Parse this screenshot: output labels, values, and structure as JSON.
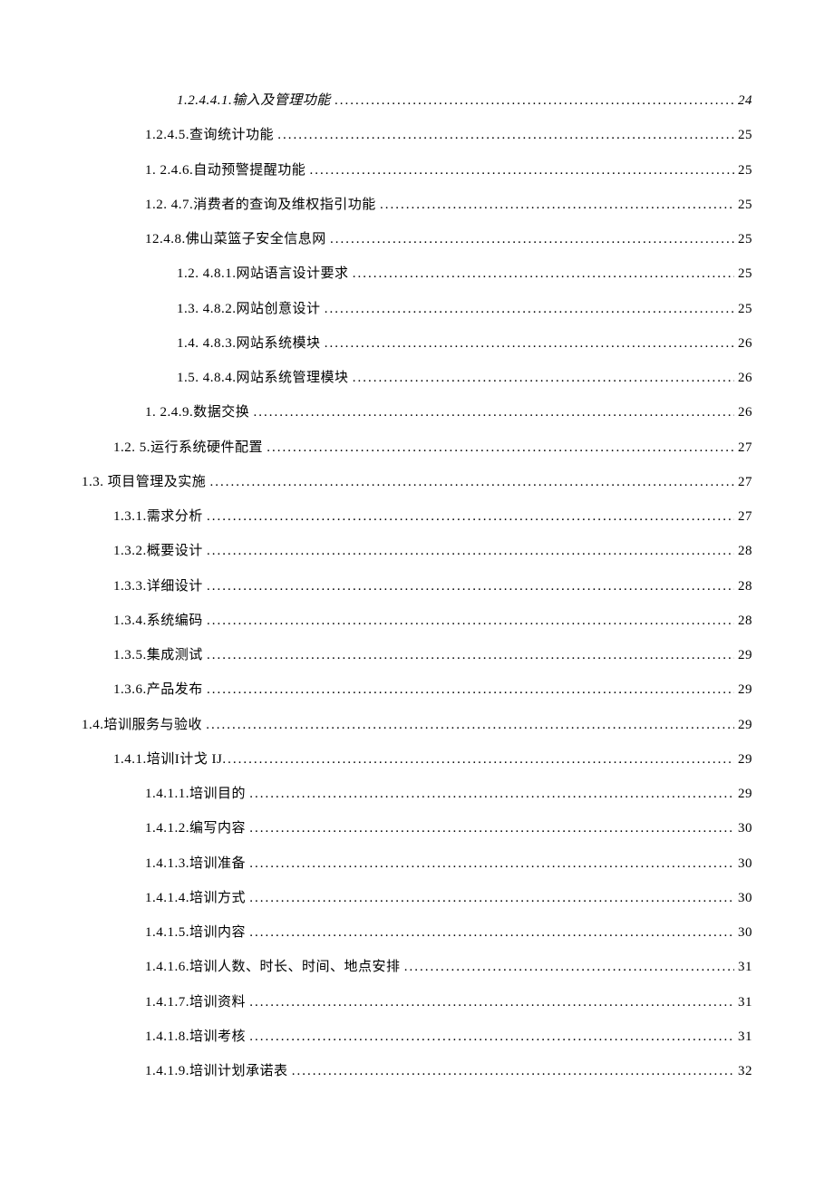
{
  "toc": [
    {
      "indent": 3,
      "label": "1.2.4.4.1.输入及管理功能 ",
      "page": "24",
      "italic": true
    },
    {
      "indent": 2,
      "label": "1.2.4.5.查询统计功能 ",
      "page": "25",
      "italic": false
    },
    {
      "indent": 2,
      "label": "1. 2.4.6.自动预警提醒功能 ",
      "page": "25",
      "italic": false
    },
    {
      "indent": 2,
      "label": "1.2. 4.7.消费者的查询及维权指引功能 ",
      "page": "25",
      "italic": false
    },
    {
      "indent": 2,
      "label": "12.4.8.佛山菜篮子安全信息网 ",
      "page": "25",
      "italic": false
    },
    {
      "indent": 3,
      "label": "1.2. 4.8.1.网站语言设计要求 ",
      "page": "25",
      "italic": false
    },
    {
      "indent": 3,
      "label": "1.3. 4.8.2.网站创意设计 ",
      "page": "25",
      "italic": false
    },
    {
      "indent": 3,
      "label": "1.4. 4.8.3.网站系统模块 ",
      "page": "26",
      "italic": false
    },
    {
      "indent": 3,
      "label": "1.5. 4.8.4.网站系统管理模块 ",
      "page": "26",
      "italic": false
    },
    {
      "indent": 2,
      "label": "1. 2.4.9.数据交换 ",
      "page": "26",
      "italic": false
    },
    {
      "indent": 1,
      "label": "1.2. 5.运行系统硬件配置 ",
      "page": "27",
      "italic": false
    },
    {
      "indent": 0,
      "label": "1.3. 项目管理及实施 ",
      "page": "27",
      "italic": false
    },
    {
      "indent": 1,
      "label": "1.3.1.需求分析 ",
      "page": "27",
      "italic": false
    },
    {
      "indent": 1,
      "label": "1.3.2.概要设计 ",
      "page": "28",
      "italic": false
    },
    {
      "indent": 1,
      "label": "1.3.3.详细设计 ",
      "page": "28",
      "italic": false
    },
    {
      "indent": 1,
      "label": "1.3.4.系统编码 ",
      "page": "28",
      "italic": false
    },
    {
      "indent": 1,
      "label": "1.3.5.集成测试 ",
      "page": "29",
      "italic": false
    },
    {
      "indent": 1,
      "label": "1.3.6.产品发布 ",
      "page": "29",
      "italic": false
    },
    {
      "indent": 0,
      "label": "1.4.培训服务与验收 ",
      "page": "29",
      "italic": false
    },
    {
      "indent": 1,
      "label": "1.4.1.培训I计戈 IJ",
      "page": "29",
      "italic": false
    },
    {
      "indent": 2,
      "label": "1.4.1.1.培训目的 ",
      "page": "29",
      "italic": false
    },
    {
      "indent": 2,
      "label": "1.4.1.2.编写内容 ",
      "page": "30",
      "italic": false
    },
    {
      "indent": 2,
      "label": "1.4.1.3.培训准备 ",
      "page": "30",
      "italic": false
    },
    {
      "indent": 2,
      "label": "1.4.1.4.培训方式 ",
      "page": "30",
      "italic": false
    },
    {
      "indent": 2,
      "label": "1.4.1.5.培训内容 ",
      "page": "30",
      "italic": false
    },
    {
      "indent": 2,
      "label": "1.4.1.6.培训人数、时长、时间、地点安排 ",
      "page": "31",
      "italic": false
    },
    {
      "indent": 2,
      "label": "1.4.1.7.培训资料 ",
      "page": "31",
      "italic": false
    },
    {
      "indent": 2,
      "label": "1.4.1.8.培训考核 ",
      "page": "31",
      "italic": false
    },
    {
      "indent": 2,
      "label": "1.4.1.9.培训计划承诺表 ",
      "page": "32",
      "italic": false
    }
  ]
}
